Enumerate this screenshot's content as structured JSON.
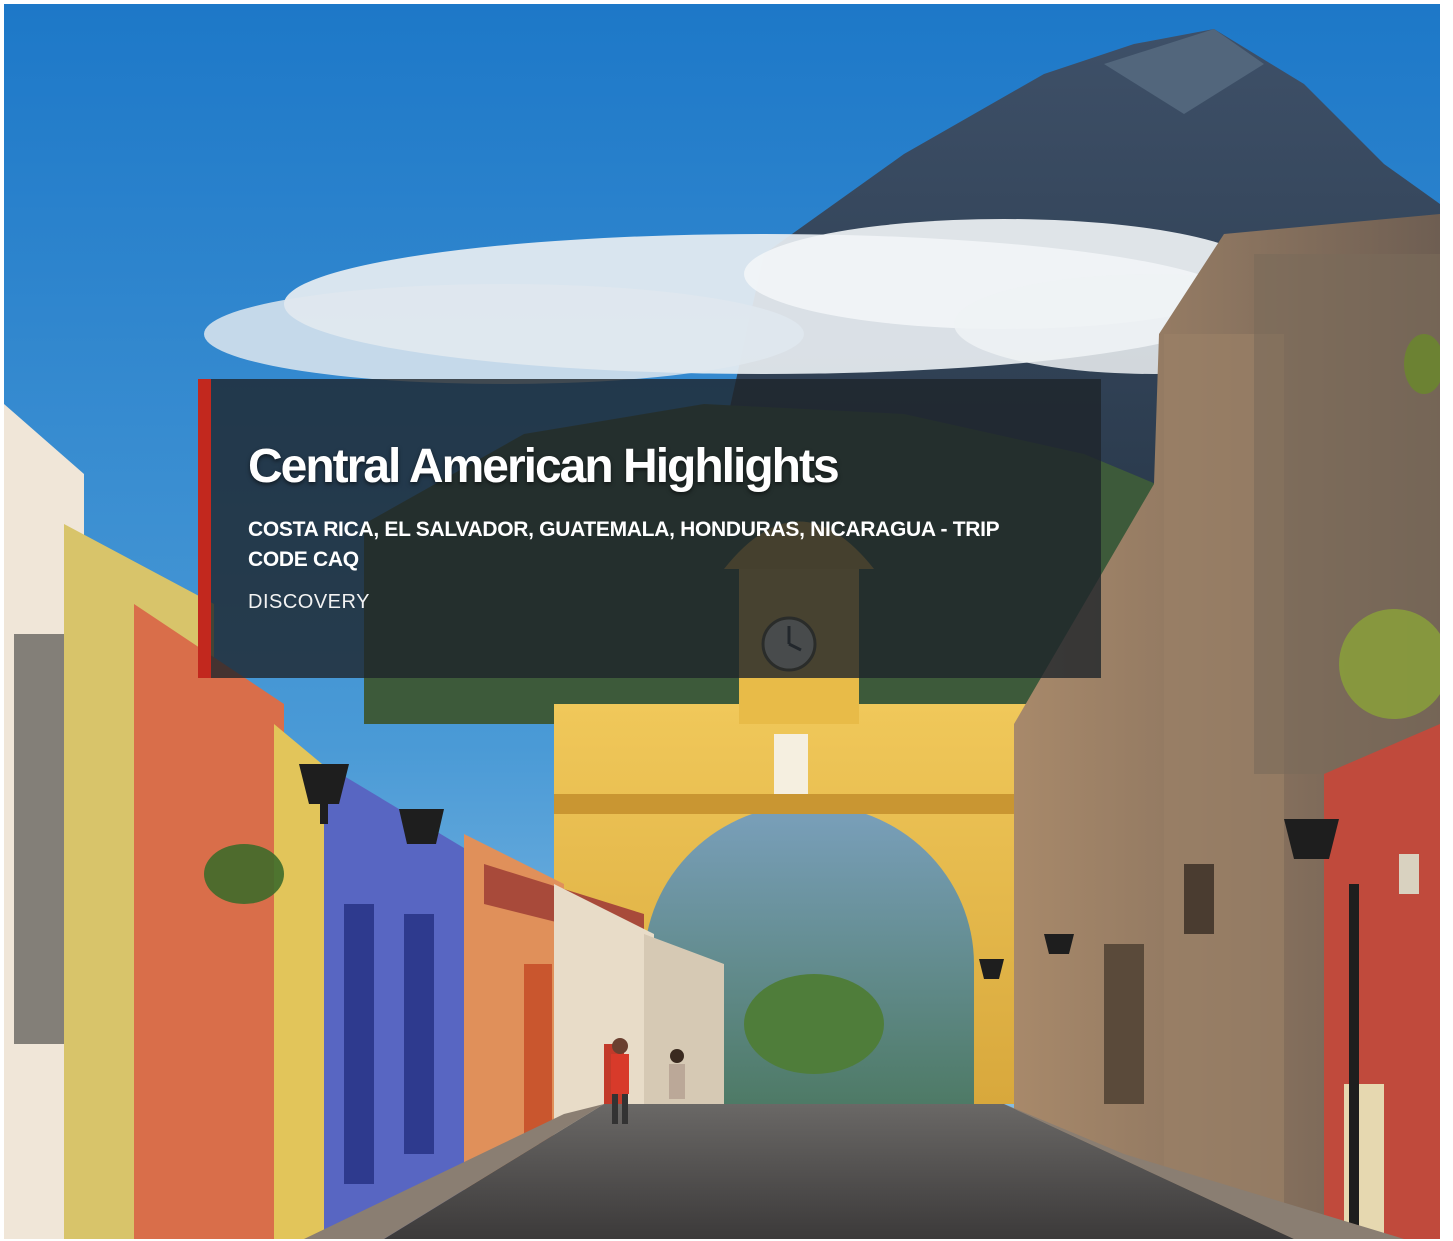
{
  "hero": {
    "image_alt": "Santa Catalina Arch with volcano in Antigua, Guatemala"
  },
  "card": {
    "title": "Central American Highlights",
    "subtitle": "COSTA RICA, EL SALVADOR, GUATEMALA, HONDURAS, NICARAGUA - TRIP CODE CAQ",
    "style": "DISCOVERY"
  },
  "colors": {
    "accent": "#c2281e",
    "card_bg": "rgba(30,36,42,0.80)",
    "sky": "#2f86c8",
    "arch": "#e2b84a"
  }
}
